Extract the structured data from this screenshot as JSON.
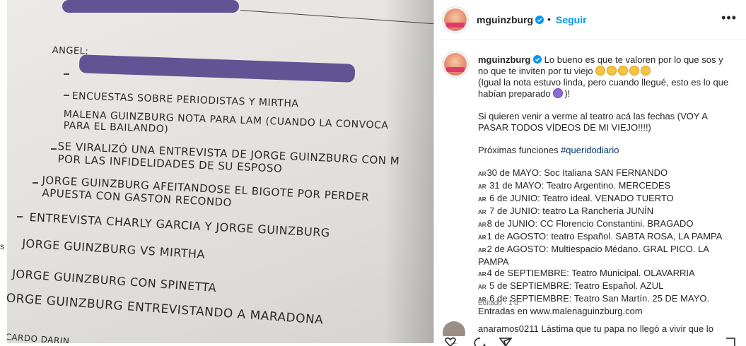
{
  "strip": {
    "text": "s"
  },
  "photo": {
    "alt": "Hoja impresa",
    "lines": [
      "ANGEL:",
      "ENCUESTAS SOBRE PERIODISTAS Y MIRTHA",
      "MALENA GUINZBURG NOTA PARA LAM (CUANDO LA CONVOCA",
      "PARA EL BAILANDO)",
      "SE VIRALIZÓ UNA ENTREVISTA DE JORGE GUINZBURG CON M",
      "POR LAS INFIDELIDADES DE SU ESPOSO",
      "JORGE GUINZBURG AFEITANDOSE EL BIGOTE POR PERDER",
      "APUESTA CON GASTON RECONDO",
      "ENTREVISTA CHARLY GARCIA Y JORGE GUINZBURG",
      "JORGE GUINZBURG VS MIRTHA",
      "JORGE GUINZBURG CON SPINETTA",
      "JORGE GUINZBURG ENTREVISTANDO A MARADONA",
      "CARDO DARIN"
    ]
  },
  "header": {
    "username": "mguinzburg",
    "dot": "•",
    "follow": "Seguir",
    "more": "•••"
  },
  "caption": {
    "username": "mguinzburg",
    "first": "Lo bueno es que te valoren por lo que sos y no que te inviten por tu viejo",
    "second_a": "(Igual la nota estuvo linda, pero cuando llegué, esto es lo que habían preparado",
    "second_b": ")!",
    "third": "Si quieren venir a verme al teatro acá las fechas (VOY A PASAR TODOS VÍDEOS DE MI VIEJO!!!!)",
    "next_label": "Próximas funciones",
    "hashtag": "#queridodiario",
    "flag": "AR",
    "dates": [
      "30 de MAYO: Soc Italiana SAN FERNANDO",
      " 31 de MAYO: Teatro Argentino. MERCEDES",
      " 6 de JUNIO: Teatro ideal. VENADO TUERTO",
      " 7 de JUNIO: teatro La Ranchería JUNÍN",
      "8 de JUNIO: CC Florencio Constantini. BRAGADO",
      "1 de AGOSTO: teatro Español. SABTA ROSA, LA PAMPA",
      "2 de AGOSTO: Multiespacio Médano. GRAL PICO. LA PAMPA",
      "4 de SEPTIEMBRE: Teatro Municipal. OLAVARRIA",
      " 5 de SEPTIEMBRE: Teatro Español. AZUL",
      " 6 de SEPTIEMBRE: Teatro San Martín. 25 DE MAYO."
    ],
    "tickets": "Entradas en www.malenaguinzburg.com"
  },
  "meta": {
    "edited": "Editado · 1 d"
  },
  "comment": {
    "text": "anaramos0211 Lástima que tu papa no llegó a vivir que lo"
  },
  "colors": {
    "accent": "#0095f6",
    "verified": "#0095f6",
    "text": "#262626",
    "muted": "#737373",
    "hashtag": "#00376b"
  }
}
